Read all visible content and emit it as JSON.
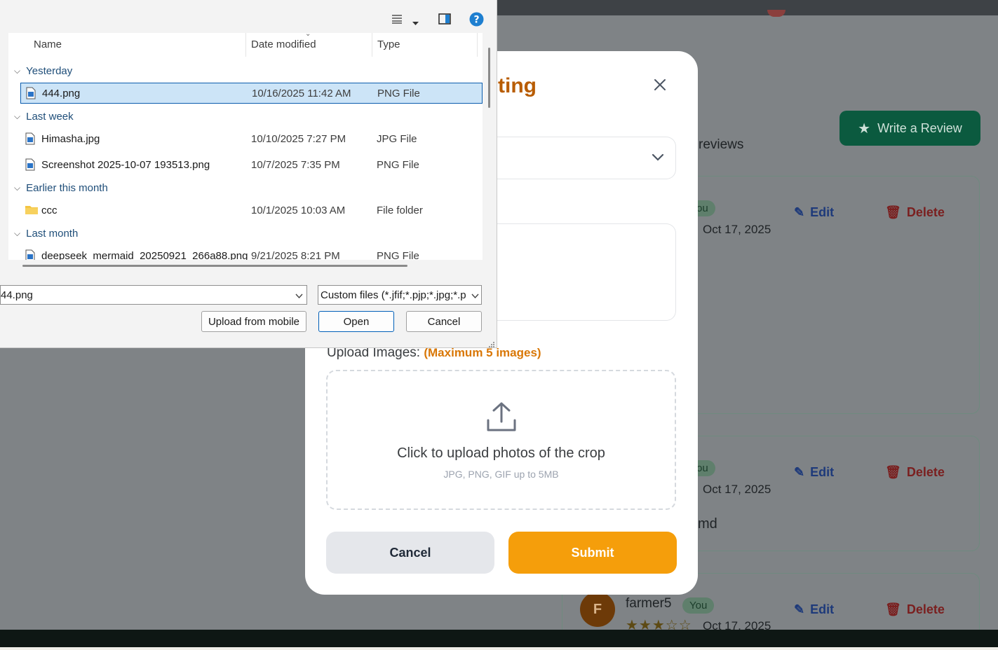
{
  "background": {
    "write_review_label": "Write a Review",
    "reviews_suffix": "reviews",
    "cards": [
      {
        "badge": "ou",
        "date": "Oct 17, 2025",
        "edit": "Edit",
        "delete": "Delete",
        "text": ""
      },
      {
        "badge": "ou",
        "date": "Oct 17, 2025",
        "edit": "Edit",
        "delete": "Delete",
        "text": "md"
      },
      {
        "avatar": "F",
        "user": "farmer5",
        "badge": "You",
        "date": "Oct 17, 2025",
        "edit": "Edit",
        "delete": "Delete",
        "rating": 3
      }
    ]
  },
  "modal": {
    "title_partial": "ting",
    "upload_label": "Upload Images:",
    "upload_max": "(Maximum 5 images)",
    "upload_main": "Click to upload photos of the crop",
    "upload_sub": "JPG, PNG, GIF up to 5MB",
    "cancel_label": "Cancel",
    "submit_label": "Submit"
  },
  "dialog": {
    "columns": {
      "name": "Name",
      "date": "Date modified",
      "type": "Type"
    },
    "groups": [
      {
        "label": "Yesterday",
        "files": [
          {
            "name": "444.png",
            "date": "10/16/2025 11:42 AM",
            "type": "PNG File",
            "selected": true,
            "icon": "image-file-icon"
          }
        ]
      },
      {
        "label": "Last week",
        "files": [
          {
            "name": "Himasha.jpg",
            "date": "10/10/2025 7:27 PM",
            "type": "JPG File",
            "icon": "image-file-icon"
          },
          {
            "name": "Screenshot 2025-10-07 193513.png",
            "date": "10/7/2025 7:35 PM",
            "type": "PNG File",
            "icon": "image-file-icon"
          }
        ]
      },
      {
        "label": "Earlier this month",
        "files": [
          {
            "name": "ccc",
            "date": "10/1/2025 10:03 AM",
            "type": "File folder",
            "icon": "folder-icon"
          }
        ]
      },
      {
        "label": "Last month",
        "files": [
          {
            "name": "deepseek_mermaid_20250921_266a88.png",
            "date": "9/21/2025 8:21 PM",
            "type": "PNG File",
            "icon": "image-file-icon"
          }
        ]
      }
    ],
    "filename_value": "44.png",
    "filetype_value": "Custom files (*.jfif;*.pjp;*.jpg;*.p",
    "upload_mobile_label": "Upload from mobile",
    "open_label": "Open",
    "cancel_label": "Cancel"
  }
}
